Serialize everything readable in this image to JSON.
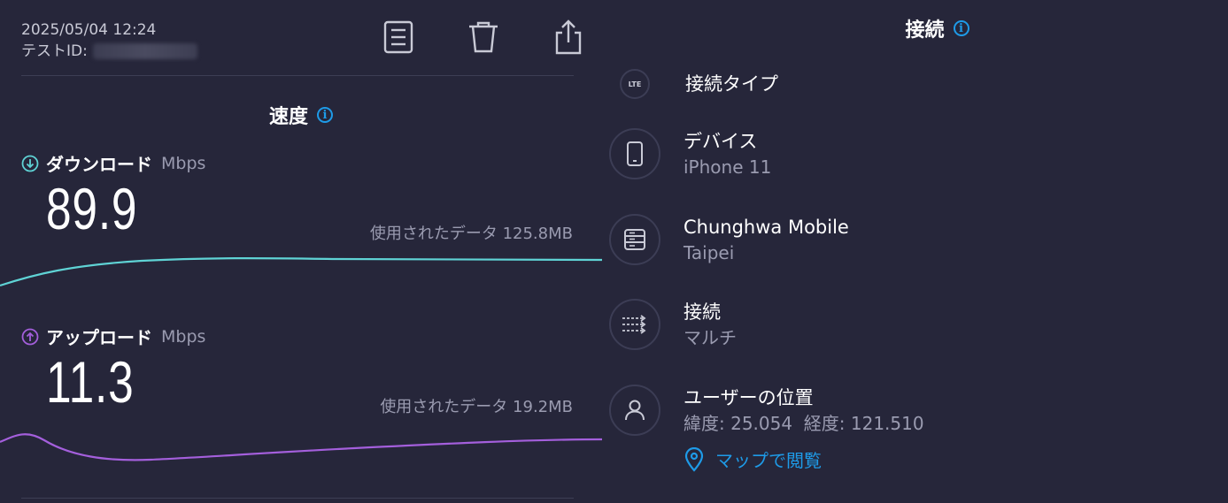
{
  "meta": {
    "timestamp": "2025/05/04 12:24",
    "test_id_label": "テストID:"
  },
  "toolbar": {
    "icons": [
      "document-icon",
      "trash-icon",
      "share-icon"
    ]
  },
  "speed": {
    "title": "速度",
    "download": {
      "label": "ダウンロード",
      "unit": "Mbps",
      "value": "89.9",
      "data_used": "使用されたデータ 125.8MB",
      "color": "#5fd3d5"
    },
    "upload": {
      "label": "アップロード",
      "unit": "Mbps",
      "value": "11.3",
      "data_used": "使用されたデータ 19.2MB",
      "color": "#a45fdc"
    }
  },
  "connection": {
    "title": "接続",
    "type_badge": "LTE",
    "type_label": "接続タイプ",
    "device": {
      "label": "デバイス",
      "value": "iPhone 11"
    },
    "provider": {
      "label": "Chunghwa Mobile",
      "value": "Taipei"
    },
    "connections": {
      "label": "接続",
      "value": "マルチ"
    },
    "location": {
      "label": "ユーザーの位置",
      "value": "緯度: 25.054  経度: 121.510"
    },
    "map_link": "マップで閲覧"
  },
  "colors": {
    "background": "#26263a",
    "accent": "#1e9be8",
    "download": "#5fd3d5",
    "upload": "#a45fdc"
  }
}
